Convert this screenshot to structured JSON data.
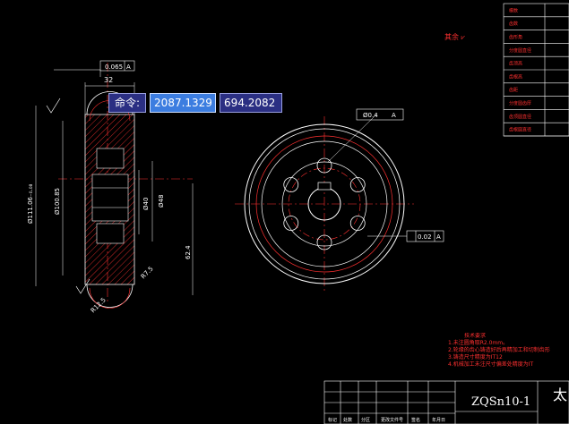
{
  "command": {
    "label": "命令:",
    "x_value": "2087.1329",
    "y_value": "694.2082"
  },
  "annotations": {
    "flatness": "0.065",
    "flatness_ref": "A",
    "runout": "Ø0.4",
    "runout_ref": "A",
    "circularity": "0.02",
    "circularity_ref": "A",
    "dim_top": "32",
    "dim_outer": "Ø111.06₋₀.₀₈",
    "dim_root": "Ø100.85",
    "dim_bore": "Ø40",
    "dim_hub": "Ø48",
    "dim_62": "62.4",
    "dim_r": "R7.5",
    "dim_chamfer": "R12.5"
  },
  "roughness_note": "其余",
  "tech_requirements": {
    "heading": "技术要求",
    "lines": [
      "1.未注圆角取R2.0mm。",
      "2.轮缘的齿心铸造好后再精加工和切制齿形",
      "3.铸造尺寸精度为IT12",
      "4.机械加工未注尺寸偏差处精度为IT"
    ]
  },
  "table_rows": [
    "模数",
    "齿数",
    "齿形角",
    "分度圆直径",
    "齿顶高",
    "齿根高",
    "齿距",
    "分度圆齿厚",
    "齿顶圆直径",
    "齿根圆直径"
  ],
  "title_block": {
    "material": "ZQSn10-1",
    "name_fragment": "太",
    "bottom_labels": [
      "标记",
      "处数",
      "分区",
      "更改文件号",
      "签名",
      "年月日"
    ]
  }
}
